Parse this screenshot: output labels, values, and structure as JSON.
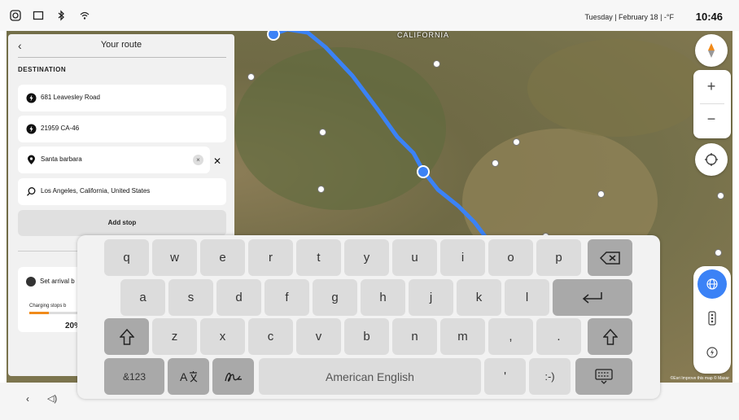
{
  "status_bar": {
    "date_text": "Tuesday | February 18 | -°F",
    "time": "10:46",
    "icons": [
      "screen-record-icon",
      "window-icon",
      "bluetooth-icon",
      "wifi-icon"
    ]
  },
  "map": {
    "region_label": "CALIFORNIA",
    "attribution": "©Esri Improve this map © Maxar",
    "route_color": "#3b82f6"
  },
  "route_panel": {
    "title": "Your route",
    "back_icon": "chevron-left-icon",
    "destination_heading": "DESTINATION",
    "stops": [
      {
        "icon": "charging-station-icon",
        "text": "681 Leavesley Road"
      },
      {
        "icon": "charging-station-icon",
        "text": "21959 CA-46"
      },
      {
        "icon": "pin-icon",
        "text": "Santa barbara"
      },
      {
        "icon": "search-icon",
        "text": "Los Angeles, California, United States"
      }
    ],
    "add_stop_label": "Add stop",
    "arrival_label": "Set arrival b",
    "charging_label": "Charging stops b",
    "charge_percent": "20%",
    "charge_fraction": 0.2,
    "accent_color": "#f08a1a"
  },
  "keyboard": {
    "row1": [
      "q",
      "w",
      "e",
      "r",
      "t",
      "y",
      "u",
      "i",
      "o",
      "p"
    ],
    "row2": [
      "a",
      "s",
      "d",
      "f",
      "g",
      "h",
      "j",
      "k",
      "l"
    ],
    "row3": [
      "z",
      "x",
      "c",
      "v",
      "b",
      "n",
      "m",
      ",",
      "."
    ],
    "symbols_label": "&123",
    "space_label": "American English",
    "apostrophe": "'",
    "emoticon": ":-)",
    "backspace_icon": "backspace-icon",
    "enter_icon": "enter-icon",
    "shift_icon": "shift-icon",
    "translate_icon": "translate-icon",
    "handwriting_icon": "handwriting-icon",
    "hide_keyboard_icon": "hide-keyboard-icon"
  }
}
